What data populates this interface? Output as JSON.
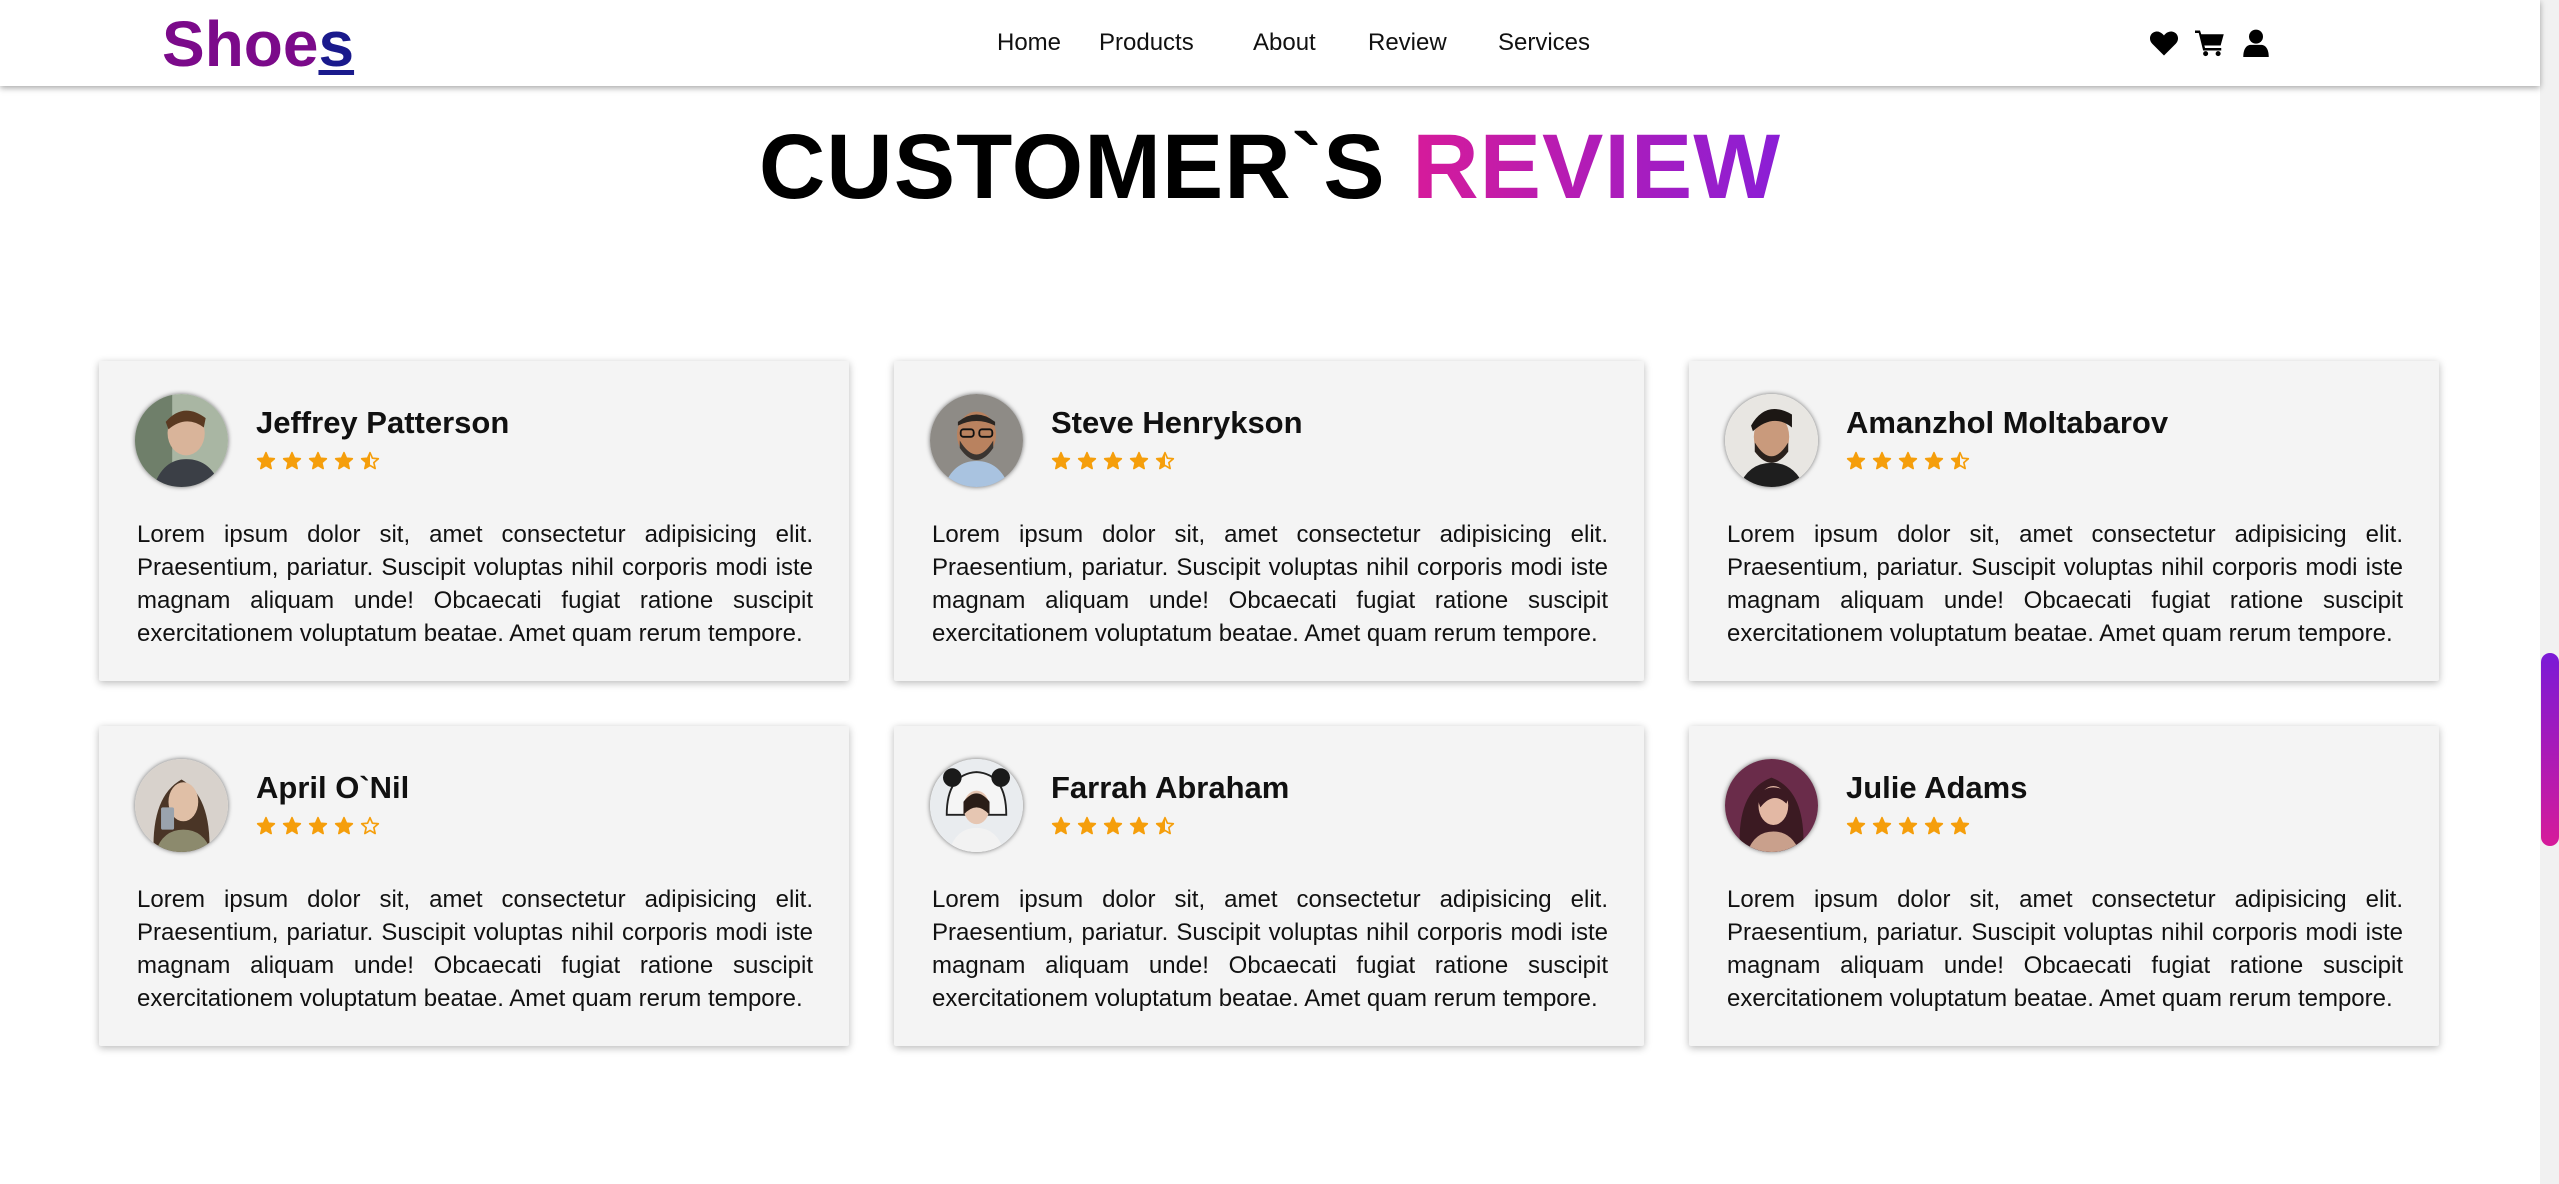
{
  "brand": {
    "logo_main": "Shoe",
    "logo_end": "s",
    "color_main": "#7b0a8a",
    "color_end": "#1a1a8c"
  },
  "nav": {
    "links": [
      "Home",
      "Products",
      "About",
      "Review",
      "Services"
    ],
    "icons": [
      "heart-icon",
      "cart-icon",
      "user-icon"
    ]
  },
  "heading": {
    "part1": "CUSTOMER`S ",
    "part2": "REVIEW",
    "accent_from": "#d61b9a",
    "accent_to": "#8a1ed6"
  },
  "star_color": "#f59e0b",
  "reviews": [
    {
      "name": "Jeffrey Patterson",
      "rating": 4.5,
      "text": "Lorem ipsum dolor sit, amet consectetur adipisicing elit. Praesentium, pariatur. Suscipit voluptas nihil corporis modi iste magnam aliquam unde! Obcaecati fugiat ratione suscipit exercitationem voluptatum beatae. Amet quam rerum tempore."
    },
    {
      "name": "Steve Henrykson",
      "rating": 4.5,
      "text": "Lorem ipsum dolor sit, amet consectetur adipisicing elit. Praesentium, pariatur. Suscipit voluptas nihil corporis modi iste magnam aliquam unde! Obcaecati fugiat ratione suscipit exercitationem voluptatum beatae. Amet quam rerum tempore."
    },
    {
      "name": "Amanzhol Moltabarov",
      "rating": 4.5,
      "text": "Lorem ipsum dolor sit, amet consectetur adipisicing elit. Praesentium, pariatur. Suscipit voluptas nihil corporis modi iste magnam aliquam unde! Obcaecati fugiat ratione suscipit exercitationem voluptatum beatae. Amet quam rerum tempore."
    },
    {
      "name": "April O`Nil",
      "rating": 4,
      "text": "Lorem ipsum dolor sit, amet consectetur adipisicing elit. Praesentium, pariatur. Suscipit voluptas nihil corporis modi iste magnam aliquam unde! Obcaecati fugiat ratione suscipit exercitationem voluptatum beatae. Amet quam rerum tempore."
    },
    {
      "name": "Farrah Abraham",
      "rating": 4.5,
      "text": "Lorem ipsum dolor sit, amet consectetur adipisicing elit. Praesentium, pariatur. Suscipit voluptas nihil corporis modi iste magnam aliquam unde! Obcaecati fugiat ratione suscipit exercitationem voluptatum beatae. Amet quam rerum tempore."
    },
    {
      "name": "Julie Adams",
      "rating": 5,
      "text": "Lorem ipsum dolor sit, amet consectetur adipisicing elit. Praesentium, pariatur. Suscipit voluptas nihil corporis modi iste magnam aliquam unde! Obcaecati fugiat ratione suscipit exercitationem voluptatum beatae. Amet quam rerum tempore."
    }
  ],
  "scrollbar": {
    "position_fraction": 0.56,
    "thumb_from": "#7a1ad6",
    "thumb_to": "#d61b9a"
  }
}
